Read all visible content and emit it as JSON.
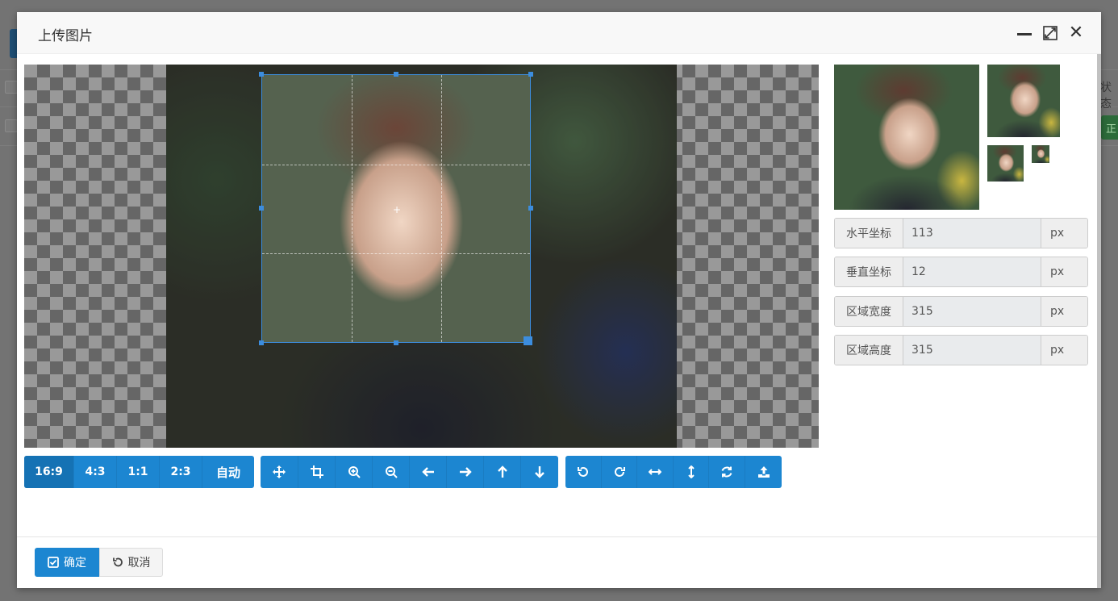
{
  "dialog": {
    "title": "上传图片"
  },
  "background": {
    "column_text": "状态",
    "badge_text": "正"
  },
  "aspect_buttons": [
    {
      "label": "16:9",
      "active": true
    },
    {
      "label": "4:3",
      "active": false
    },
    {
      "label": "1:1",
      "active": false
    },
    {
      "label": "2:3",
      "active": false
    },
    {
      "label": "自动",
      "active": false
    }
  ],
  "tool_buttons": [
    "move-icon",
    "crop-icon",
    "zoom-in-icon",
    "zoom-out-icon",
    "arrow-left-icon",
    "arrow-right-icon",
    "arrow-up-icon",
    "arrow-down-icon"
  ],
  "transform_buttons": [
    "rotate-left-icon",
    "rotate-right-icon",
    "flip-horizontal-icon",
    "flip-vertical-icon",
    "reset-icon",
    "upload-icon"
  ],
  "fields": [
    {
      "label": "水平坐标",
      "value": "113",
      "unit": "px"
    },
    {
      "label": "垂直坐标",
      "value": "12",
      "unit": "px"
    },
    {
      "label": "区域宽度",
      "value": "315",
      "unit": "px"
    },
    {
      "label": "区域高度",
      "value": "315",
      "unit": "px"
    }
  ],
  "crop_center_mark": "+",
  "footer": {
    "confirm_label": "确定",
    "cancel_label": "取消"
  },
  "colors": {
    "primary": "#1c86d1",
    "crop_border": "#3c8dde"
  }
}
